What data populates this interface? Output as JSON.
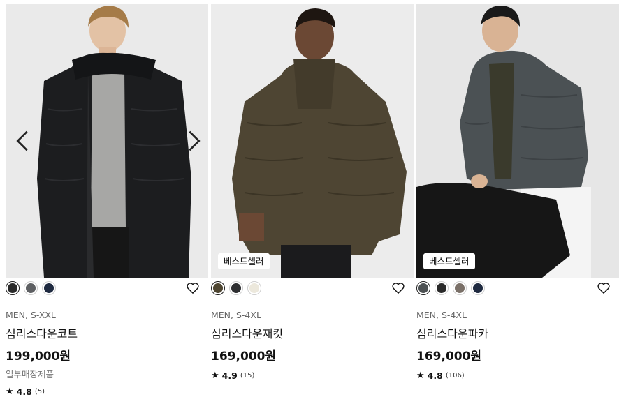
{
  "products": [
    {
      "name": "심리스다운코트",
      "meta": "MEN, S-XXL",
      "price": "199,000원",
      "note": "일부매장제품",
      "rating": "4.8",
      "review_count": "(5)",
      "badge": "",
      "image_icon": "black-down-coat-photo",
      "colors": [
        "#2b2b2b",
        "#5e6063",
        "#1f2a40"
      ],
      "selected_color": 0
    },
    {
      "name": "심리스다운재킷",
      "meta": "MEN, S-4XL",
      "price": "169,000원",
      "note": "",
      "rating": "4.9",
      "review_count": "(15)",
      "badge": "베스트셀러",
      "image_icon": "olive-down-jacket-photo",
      "colors": [
        "#4f4632",
        "#2e2f31",
        "#ece8dc"
      ],
      "selected_color": 0
    },
    {
      "name": "심리스다운파카",
      "meta": "MEN, S-4XL",
      "price": "169,000원",
      "note": "",
      "rating": "4.8",
      "review_count": "(106)",
      "badge": "베스트셀러",
      "image_icon": "grey-down-parka-photo",
      "colors": [
        "#4d5153",
        "#2a2a2a",
        "#7a7068",
        "#1f2a40"
      ],
      "selected_color": 0
    }
  ],
  "icons": {
    "prev": "chevron-left-icon",
    "next": "chevron-right-icon",
    "wishlist": "heart-outline-icon",
    "star": "star-icon"
  },
  "star_glyph": "★"
}
